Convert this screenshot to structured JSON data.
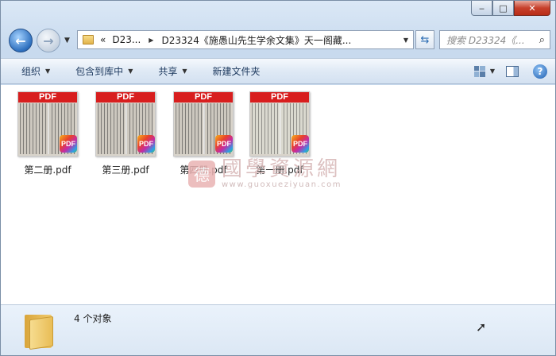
{
  "window": {
    "minimize": "▭",
    "maximize": "□",
    "close": "✕"
  },
  "nav": {
    "back": "←",
    "forward": "→",
    "address_prefix": "«",
    "crumb1": "D23...",
    "crumb2": "D23324《施愚山先生学余文集》天一阁藏...",
    "search_placeholder": "搜索 D23324《..."
  },
  "toolbar": {
    "organize": "组织",
    "include_in_library": "包含到库中",
    "share": "共享",
    "new_folder": "新建文件夹"
  },
  "files": [
    {
      "name": "第二册.pdf",
      "banner": "PDF",
      "badge": "PDF"
    },
    {
      "name": "第三册.pdf",
      "banner": "PDF",
      "badge": "PDF"
    },
    {
      "name": "第四册.pdf",
      "banner": "PDF",
      "badge": "PDF"
    },
    {
      "name": "第一册.pdf",
      "banner": "PDF",
      "badge": "PDF"
    }
  ],
  "watermark": {
    "seal": "德",
    "title": "國學資源網",
    "url": "www.guoxueziyuan.com"
  },
  "status": {
    "count": "4 个对象"
  }
}
